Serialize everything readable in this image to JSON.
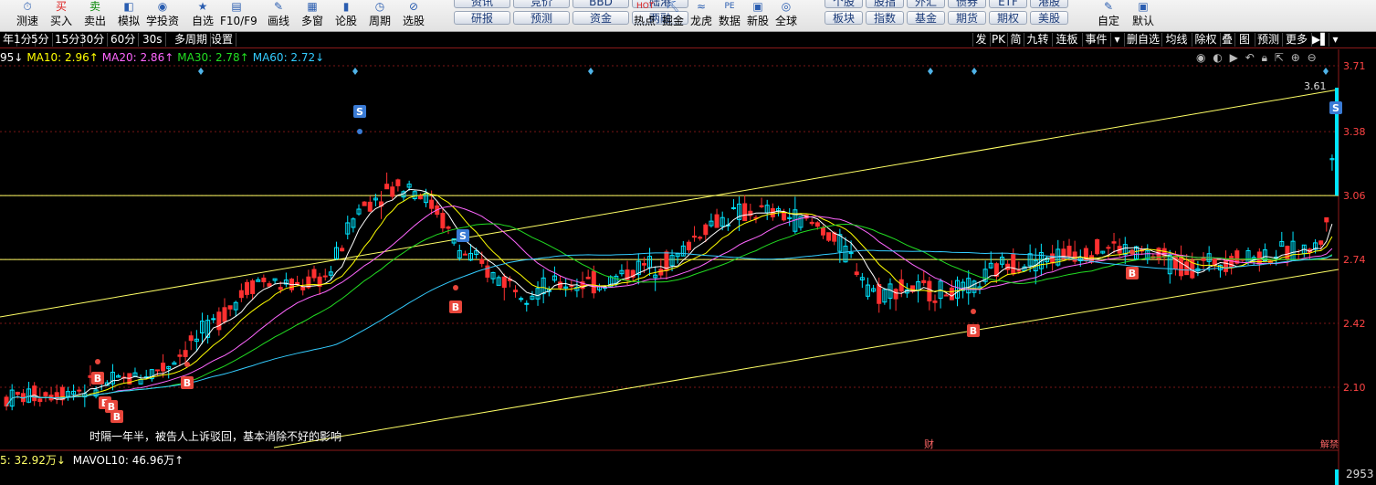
{
  "toolbar": {
    "items": [
      {
        "label": "测速",
        "icon": "stopwatch-icon",
        "glyph": "⏱"
      },
      {
        "label": "买入",
        "icon": "buy-icon",
        "glyph": "买"
      },
      {
        "label": "卖出",
        "icon": "sell-icon",
        "glyph": "卖"
      },
      {
        "label": "模拟",
        "icon": "simulate-icon",
        "glyph": "◧"
      },
      {
        "label": "学投资",
        "icon": "learn-icon",
        "glyph": "◉"
      },
      {
        "label": "自选",
        "icon": "star-icon",
        "glyph": "★"
      },
      {
        "label": "F10/F9",
        "icon": "f10-icon",
        "glyph": "▤"
      },
      {
        "label": "画线",
        "icon": "pen-icon",
        "glyph": "✎"
      },
      {
        "label": "多窗",
        "icon": "multiwindow-icon",
        "glyph": "▦"
      },
      {
        "label": "论股",
        "icon": "discuss-icon",
        "glyph": "▮"
      },
      {
        "label": "周期",
        "icon": "clock-icon",
        "glyph": "◷"
      },
      {
        "label": "选股",
        "icon": "pick-stock-icon",
        "glyph": "⊘"
      }
    ],
    "pills_top": [
      "资讯",
      "竞价",
      "BBD",
      "陆港"
    ],
    "pills_bottom": [
      "研报",
      "预测",
      "资金",
      "两融"
    ],
    "items2": [
      {
        "label": "热点",
        "icon": "hot-icon",
        "glyph": "HOT"
      },
      {
        "label": "掘金",
        "icon": "shovel-icon",
        "glyph": "⛏"
      },
      {
        "label": "龙虎",
        "icon": "dragon-tiger-icon",
        "glyph": "≈"
      },
      {
        "label": "数据",
        "icon": "pe-data-icon",
        "glyph": "PE"
      },
      {
        "label": "新股",
        "icon": "new-stock-icon",
        "glyph": "▣"
      },
      {
        "label": "全球",
        "icon": "globe-icon",
        "glyph": "◎"
      }
    ],
    "pills2_top": [
      "个股",
      "股指",
      "外汇",
      "债券",
      "ETF",
      "港股"
    ],
    "pills2_bottom": [
      "板块",
      "指数",
      "基金",
      "期货",
      "期权",
      "美股"
    ],
    "items3": [
      {
        "label": "自定",
        "icon": "custom-icon",
        "glyph": "✎"
      },
      {
        "label": "默认",
        "icon": "default-icon",
        "glyph": "▣"
      }
    ]
  },
  "period_bar": {
    "left": [
      "年",
      "1分",
      "5分",
      "15分",
      "30分",
      "60分",
      "30s",
      "多周期",
      "设置"
    ],
    "right": [
      "发",
      "PK",
      "简",
      "九转",
      "连板",
      "事件",
      "▾",
      "删自选",
      "均线",
      "除权",
      "叠",
      "图",
      "预测",
      "更多",
      "▶▌",
      "▾"
    ]
  },
  "ma_legend": [
    {
      "text": "95↓",
      "color": "#ffffff"
    },
    {
      "text": "MA10: 2.96↑",
      "color": "#ffff00"
    },
    {
      "text": "MA20: 2.86↑",
      "color": "#ff66ff"
    },
    {
      "text": "MA30: 2.78↑",
      "color": "#22dd22"
    },
    {
      "text": "MA60: 2.72↓",
      "color": "#33ccff"
    }
  ],
  "price_axis": [
    "3.71",
    "3.38",
    "3.06",
    "2.74",
    "2.42",
    "2.10"
  ],
  "max_label": "3.61",
  "annotation": "时隔一年半，被告人上诉驳回，基本消除不好的影响",
  "event_caiwu": "财",
  "event_right": "解禁",
  "volume": {
    "mavol5": "5: 32.92万↓",
    "mavol10": "MAVOL10: 46.96万↑",
    "axis": "2953"
  },
  "colors": {
    "up": "#00e5ff",
    "down": "#ff3030",
    "channel": "#ffff66",
    "hline": "#ffff66",
    "buy": "#e8463b",
    "sell": "#3a7bd5"
  },
  "chart_data": {
    "type": "candlestick",
    "y_axis_ticks": [
      3.71,
      3.38,
      3.06,
      2.74,
      2.42,
      2.1
    ],
    "ylim": [
      1.9,
      3.76
    ],
    "horizontal_lines": [
      3.06,
      2.74
    ],
    "max_label": 3.61,
    "markers": [
      {
        "type": "S",
        "label": "S"
      },
      {
        "type": "S",
        "label": "S"
      },
      {
        "type": "S",
        "label": "S"
      },
      {
        "type": "B",
        "label": "B"
      },
      {
        "type": "B",
        "label": "B"
      },
      {
        "type": "B",
        "label": "B"
      },
      {
        "type": "B",
        "label": "B"
      },
      {
        "type": "B",
        "label": "B"
      },
      {
        "type": "B",
        "label": "B"
      },
      {
        "type": "B",
        "label": "B"
      }
    ]
  }
}
